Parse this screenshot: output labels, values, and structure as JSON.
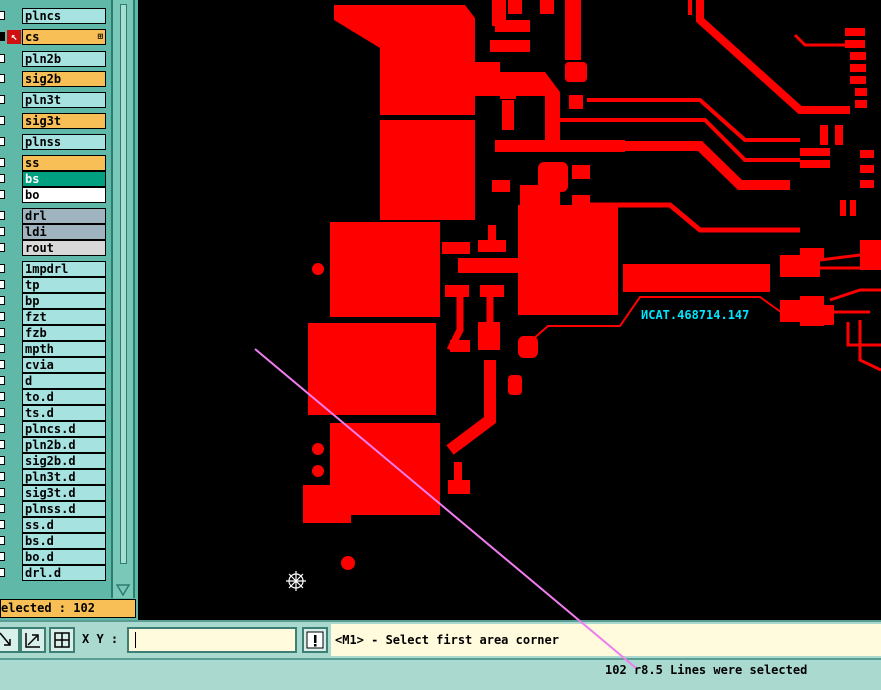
{
  "colors": {
    "trace": "#ff0000",
    "label": "#00e5ff",
    "selection_line": "#f07cf0",
    "highlight": "#f7bf55",
    "teal": "#00a080"
  },
  "layers": [
    {
      "name": "plncs",
      "color": "#a6e2e0",
      "dark": false
    },
    {
      "name": "cs",
      "color": "#f7bf55",
      "dark": true,
      "icon": "arrow-icon"
    },
    {
      "name": "pln2b",
      "color": "#a6e2e0",
      "dark": false
    },
    {
      "name": "sig2b",
      "color": "#f7bf55",
      "dark": false
    },
    {
      "name": "pln3t",
      "color": "#a6e2e0",
      "dark": false
    },
    {
      "name": "sig3t",
      "color": "#f7bf55",
      "dark": false
    },
    {
      "name": "plnss",
      "color": "#a6e2e0",
      "dark": false
    },
    {
      "name": "ss",
      "color": "#f7bf55",
      "dark": false
    },
    {
      "name": "bs",
      "color": "#00a080",
      "dark": false
    },
    {
      "name": "bo",
      "color": "#ffffff",
      "dark": false
    },
    {
      "name": "drl",
      "color": "#9fb4bf",
      "dark": false
    },
    {
      "name": "ldi",
      "color": "#9fb4bf",
      "dark": false
    },
    {
      "name": "rout",
      "color": "#d8d8d8",
      "dark": false
    },
    {
      "name": "1mpdrl",
      "color": "#a6e2e0",
      "dark": false
    },
    {
      "name": "tp",
      "color": "#a6e2e0",
      "dark": false
    },
    {
      "name": "bp",
      "color": "#a6e2e0",
      "dark": false
    },
    {
      "name": "fzt",
      "color": "#a6e2e0",
      "dark": false
    },
    {
      "name": "fzb",
      "color": "#a6e2e0",
      "dark": false
    },
    {
      "name": "mpth",
      "color": "#a6e2e0",
      "dark": false
    },
    {
      "name": "cvia",
      "color": "#a6e2e0",
      "dark": false
    },
    {
      "name": "d",
      "color": "#a6e2e0",
      "dark": false
    },
    {
      "name": "to.d",
      "color": "#a6e2e0",
      "dark": false
    },
    {
      "name": "ts.d",
      "color": "#a6e2e0",
      "dark": false
    },
    {
      "name": "plncs.d",
      "color": "#a6e2e0",
      "dark": false
    },
    {
      "name": "pln2b.d",
      "color": "#a6e2e0",
      "dark": false
    },
    {
      "name": "sig2b.d",
      "color": "#a6e2e0",
      "dark": false
    },
    {
      "name": "pln3t.d",
      "color": "#a6e2e0",
      "dark": false
    },
    {
      "name": "sig3t.d",
      "color": "#a6e2e0",
      "dark": false
    },
    {
      "name": "plnss.d",
      "color": "#a6e2e0",
      "dark": false
    },
    {
      "name": "ss.d",
      "color": "#a6e2e0",
      "dark": false
    },
    {
      "name": "bs.d",
      "color": "#a6e2e0",
      "dark": false
    },
    {
      "name": "bo.d",
      "color": "#a6e2e0",
      "dark": false
    },
    {
      "name": "drl.d",
      "color": "#a6e2e0",
      "dark": false
    }
  ],
  "sidebar": {
    "selected_text": "elected : 102",
    "scroll_icon": "triangle-down-icon"
  },
  "canvas": {
    "board_label": "ИСАТ.468714.147"
  },
  "toolbar": {
    "xy_label": "X Y :",
    "xy_value": "",
    "prompt": "<M1> - Select first area corner",
    "alert_icon": "exclamation-icon"
  },
  "status": {
    "message": "102 r8.5 Lines were selected"
  }
}
